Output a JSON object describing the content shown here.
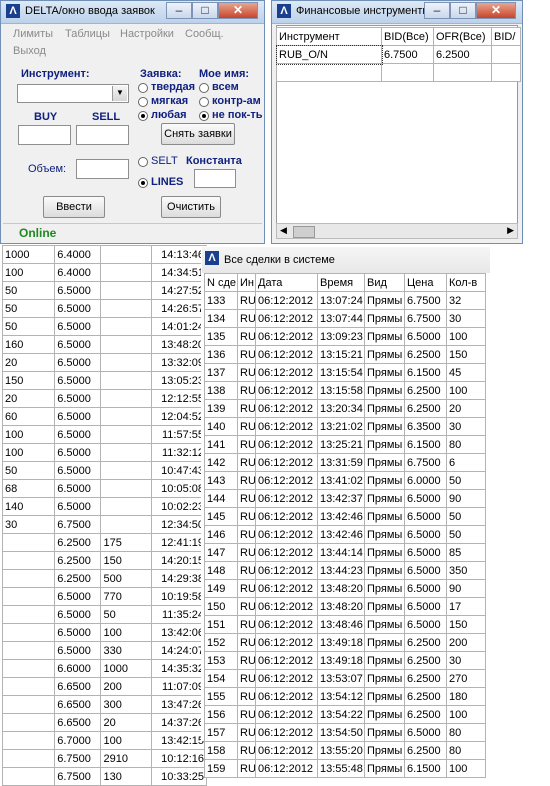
{
  "order_window": {
    "title": "DELTA/окно ввода заявок",
    "menu": [
      "Лимиты",
      "Таблицы",
      "Настройки",
      "Сообщ.",
      "Выход"
    ],
    "instrument_label": "Инструмент:",
    "instrument_value": "",
    "buy_label": "BUY",
    "sell_label": "SELL",
    "order_label": "Заявка:",
    "order_options": [
      "твердая",
      "мягкая",
      "любая"
    ],
    "name_label": "Мое имя:",
    "name_options": [
      "всем",
      "контр-ам",
      "не пок-ть"
    ],
    "cancel_button": "Снять заявки",
    "volume_label": "Объем:",
    "selt_label": "SELT",
    "lines_label": "LINES",
    "const_label": "Константа",
    "enter_button": "Ввести",
    "clear_button": "Очистить",
    "status": "Online"
  },
  "fin_window": {
    "title": "Финансовые инструменты",
    "headers": [
      "Инструмент",
      "BID(Все)",
      "OFR(Все)",
      "BID/"
    ],
    "rows": [
      [
        "RUB_O/N",
        "6.7500",
        "6.2500",
        ""
      ]
    ]
  },
  "left_table": {
    "rows": [
      [
        "1000",
        "6.4000",
        "",
        "14:13:46"
      ],
      [
        "100",
        "6.4000",
        "",
        "14:34:51"
      ],
      [
        "50",
        "6.5000",
        "",
        "14:27:52"
      ],
      [
        "50",
        "6.5000",
        "",
        "14:26:57"
      ],
      [
        "50",
        "6.5000",
        "",
        "14:01:24"
      ],
      [
        "160",
        "6.5000",
        "",
        "13:48:20"
      ],
      [
        "20",
        "6.5000",
        "",
        "13:32:09"
      ],
      [
        "150",
        "6.5000",
        "",
        "13:05:23"
      ],
      [
        "20",
        "6.5000",
        "",
        "12:12:55"
      ],
      [
        "60",
        "6.5000",
        "",
        "12:04:52"
      ],
      [
        "100",
        "6.5000",
        "",
        "11:57:55"
      ],
      [
        "100",
        "6.5000",
        "",
        "11:32:12"
      ],
      [
        "50",
        "6.5000",
        "",
        "10:47:43"
      ],
      [
        "68",
        "6.5000",
        "",
        "10:05:08"
      ],
      [
        "140",
        "6.5000",
        "",
        "10:02:23"
      ],
      [
        "30",
        "6.7500",
        "",
        "12:34:50"
      ],
      [
        "",
        "6.2500",
        "175",
        "12:41:19"
      ],
      [
        "",
        "6.2500",
        "150",
        "14:20:15"
      ],
      [
        "",
        "6.2500",
        "500",
        "14:29:38"
      ],
      [
        "",
        "6.5000",
        "770",
        "10:19:58"
      ],
      [
        "",
        "6.5000",
        "50",
        "11:35:24"
      ],
      [
        "",
        "6.5000",
        "100",
        "13:42:06"
      ],
      [
        "",
        "6.5000",
        "330",
        "14:24:07"
      ],
      [
        "",
        "6.6000",
        "1000",
        "14:35:32"
      ],
      [
        "",
        "6.6500",
        "200",
        "11:07:09"
      ],
      [
        "",
        "6.6500",
        "300",
        "13:47:26"
      ],
      [
        "",
        "6.6500",
        "20",
        "14:37:26"
      ],
      [
        "",
        "6.7000",
        "100",
        "13:42:15"
      ],
      [
        "",
        "6.7500",
        "2910",
        "10:12:16"
      ],
      [
        "",
        "6.7500",
        "130",
        "10:33:25"
      ]
    ]
  },
  "deals_window": {
    "title": "Все сделки в системе",
    "headers": [
      "N сде",
      "Ин",
      "Дата",
      "Время",
      "Вид",
      "Цена",
      "Кол-в"
    ],
    "rows": [
      [
        "133",
        "RU",
        "06:12:2012",
        "13:07:24",
        "Прямы",
        "6.7500",
        "32"
      ],
      [
        "134",
        "RU",
        "06:12:2012",
        "13:07:44",
        "Прямы",
        "6.7500",
        "30"
      ],
      [
        "135",
        "RU",
        "06:12:2012",
        "13:09:23",
        "Прямы",
        "6.5000",
        "100"
      ],
      [
        "136",
        "RU",
        "06:12:2012",
        "13:15:21",
        "Прямы",
        "6.2500",
        "150"
      ],
      [
        "137",
        "RU",
        "06:12:2012",
        "13:15:54",
        "Прямы",
        "6.1500",
        "45"
      ],
      [
        "138",
        "RU",
        "06:12:2012",
        "13:15:58",
        "Прямы",
        "6.2500",
        "100"
      ],
      [
        "139",
        "RU",
        "06:12:2012",
        "13:20:34",
        "Прямы",
        "6.2500",
        "20"
      ],
      [
        "140",
        "RU",
        "06:12:2012",
        "13:21:02",
        "Прямы",
        "6.3500",
        "30"
      ],
      [
        "141",
        "RU",
        "06:12:2012",
        "13:25:21",
        "Прямы",
        "6.1500",
        "80"
      ],
      [
        "142",
        "RU",
        "06:12:2012",
        "13:31:59",
        "Прямы",
        "6.7500",
        "6"
      ],
      [
        "143",
        "RU",
        "06:12:2012",
        "13:41:02",
        "Прямы",
        "6.0000",
        "50"
      ],
      [
        "144",
        "RU",
        "06:12:2012",
        "13:42:37",
        "Прямы",
        "6.5000",
        "90"
      ],
      [
        "145",
        "RU",
        "06:12:2012",
        "13:42:46",
        "Прямы",
        "6.5000",
        "50"
      ],
      [
        "146",
        "RU",
        "06:12:2012",
        "13:42:46",
        "Прямы",
        "6.5000",
        "50"
      ],
      [
        "147",
        "RU",
        "06:12:2012",
        "13:44:14",
        "Прямы",
        "6.5000",
        "85"
      ],
      [
        "148",
        "RU",
        "06:12:2012",
        "13:44:23",
        "Прямы",
        "6.5000",
        "350"
      ],
      [
        "149",
        "RU",
        "06:12:2012",
        "13:48:20",
        "Прямы",
        "6.5000",
        "90"
      ],
      [
        "150",
        "RU",
        "06:12:2012",
        "13:48:20",
        "Прямы",
        "6.5000",
        "17"
      ],
      [
        "151",
        "RU",
        "06:12:2012",
        "13:48:46",
        "Прямы",
        "6.5000",
        "150"
      ],
      [
        "152",
        "RU",
        "06:12:2012",
        "13:49:18",
        "Прямы",
        "6.2500",
        "200"
      ],
      [
        "153",
        "RU",
        "06:12:2012",
        "13:49:18",
        "Прямы",
        "6.2500",
        "30"
      ],
      [
        "154",
        "RU",
        "06:12:2012",
        "13:53:07",
        "Прямы",
        "6.2500",
        "270"
      ],
      [
        "155",
        "RU",
        "06:12:2012",
        "13:54:12",
        "Прямы",
        "6.2500",
        "180"
      ],
      [
        "156",
        "RU",
        "06:12:2012",
        "13:54:22",
        "Прямы",
        "6.2500",
        "100"
      ],
      [
        "157",
        "RU",
        "06:12:2012",
        "13:54:50",
        "Прямы",
        "6.5000",
        "80"
      ],
      [
        "158",
        "RU",
        "06:12:2012",
        "13:55:20",
        "Прямы",
        "6.2500",
        "80"
      ],
      [
        "159",
        "RU",
        "06:12:2012",
        "13:55:48",
        "Прямы",
        "6.1500",
        "100"
      ]
    ]
  }
}
